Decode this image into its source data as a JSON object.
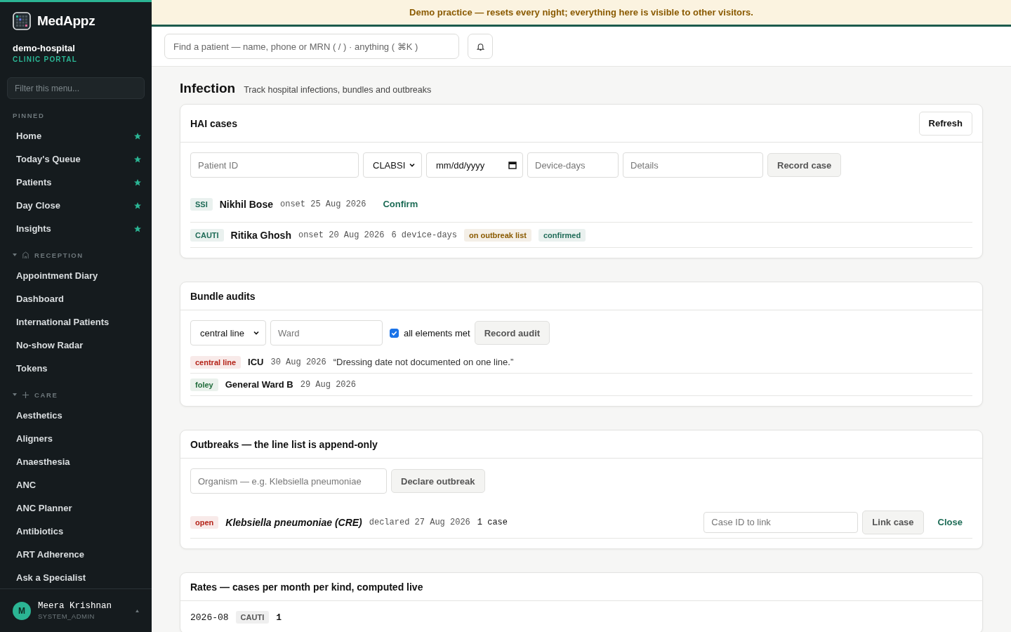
{
  "sidebar": {
    "brand": "MedAppz",
    "org": "demo-hospital",
    "portal": "CLINIC PORTAL",
    "filter_placeholder": "Filter this menu...",
    "sections": [
      {
        "title": "PINNED",
        "kind": "pinned",
        "items": [
          {
            "label": "Home",
            "pinned": true
          },
          {
            "label": "Today's Queue",
            "pinned": true
          },
          {
            "label": "Patients",
            "pinned": true
          },
          {
            "label": "Day Close",
            "pinned": true
          },
          {
            "label": "Insights",
            "pinned": true
          }
        ]
      },
      {
        "title": "RECEPTION",
        "kind": "reception",
        "expanded": true,
        "items": [
          {
            "label": "Appointment Diary",
            "pinned": false
          },
          {
            "label": "Dashboard",
            "pinned": false
          },
          {
            "label": "International Patients",
            "pinned": false
          },
          {
            "label": "No-show Radar",
            "pinned": false
          },
          {
            "label": "Tokens",
            "pinned": false
          }
        ]
      },
      {
        "title": "CARE",
        "kind": "care",
        "expanded": true,
        "items": [
          {
            "label": "Aesthetics",
            "pinned": false
          },
          {
            "label": "Aligners",
            "pinned": false
          },
          {
            "label": "Anaesthesia",
            "pinned": false
          },
          {
            "label": "ANC",
            "pinned": false
          },
          {
            "label": "ANC Planner",
            "pinned": false
          },
          {
            "label": "Antibiotics",
            "pinned": false
          },
          {
            "label": "ART Adherence",
            "pinned": false
          },
          {
            "label": "Ask a Specialist",
            "pinned": false
          }
        ]
      }
    ],
    "user": {
      "initial": "M",
      "name": "Meera Krishnan",
      "role": "SYSTEM_ADMIN"
    }
  },
  "banner": "Demo practice — resets every night; everything here is visible to other visitors.",
  "search": {
    "placeholder": "Find a patient — name, phone or MRN ( / ) · anything ( ⌘K )"
  },
  "page": {
    "title": "Infection",
    "subtitle": "Track hospital infections, bundles and outbreaks"
  },
  "hai": {
    "title": "HAI cases",
    "refresh": "Refresh",
    "patient_placeholder": "Patient ID",
    "kind_value": "CLABSI",
    "date_value": "mm/dd/yyyy",
    "device_placeholder": "Device-days",
    "details_placeholder": "Details",
    "record": "Record case",
    "rows": [
      {
        "tag": {
          "label": "SSI",
          "color": "#1f6b57"
        },
        "name": "Nikhil Bose",
        "meta": [
          "onset 25 Aug 2026"
        ],
        "action": "Confirm",
        "badges": []
      },
      {
        "tag": {
          "label": "CAUTI",
          "color": "#1f6b57"
        },
        "name": "Ritika Ghosh",
        "meta": [
          "onset 20 Aug 2026",
          "6 device-days"
        ],
        "badges": [
          {
            "label": "on outbreak list",
            "color": "#8a5a00"
          },
          {
            "label": "confirmed",
            "color": "#1f6b57"
          }
        ]
      }
    ]
  },
  "bundles": {
    "title": "Bundle audits",
    "bundle_value": "central line",
    "ward_placeholder": "Ward",
    "checkbox": {
      "label": "all elements met",
      "checked": true
    },
    "record": "Record audit",
    "rows": [
      {
        "tag": {
          "label": "central line",
          "color": "#b42318"
        },
        "ward": "ICU",
        "date": "30 Aug 2026",
        "note": "“Dressing date not documented on one line.”"
      },
      {
        "tag": {
          "label": "foley",
          "color": "#1f6b3a"
        },
        "ward": "General Ward B",
        "date": "29 Aug 2026"
      }
    ]
  },
  "outbreaks": {
    "title": "Outbreaks — the line list is append-only",
    "organism_placeholder": "Organism — e.g. Klebsiella pneumoniae",
    "declare": "Declare outbreak",
    "rows": [
      {
        "tag": {
          "label": "open",
          "color": "#b42318"
        },
        "organism": "Klebsiella pneumoniae (CRE)",
        "declared": "declared 27 Aug 2026",
        "cases": "1 case",
        "case_placeholder": "Case ID to link",
        "link": "Link case",
        "close": "Close"
      }
    ]
  },
  "rates": {
    "title": "Rates — cases per month per kind, computed live",
    "rows": [
      {
        "month": "2026-08",
        "kind": "CAUTI",
        "count": "1"
      }
    ]
  }
}
